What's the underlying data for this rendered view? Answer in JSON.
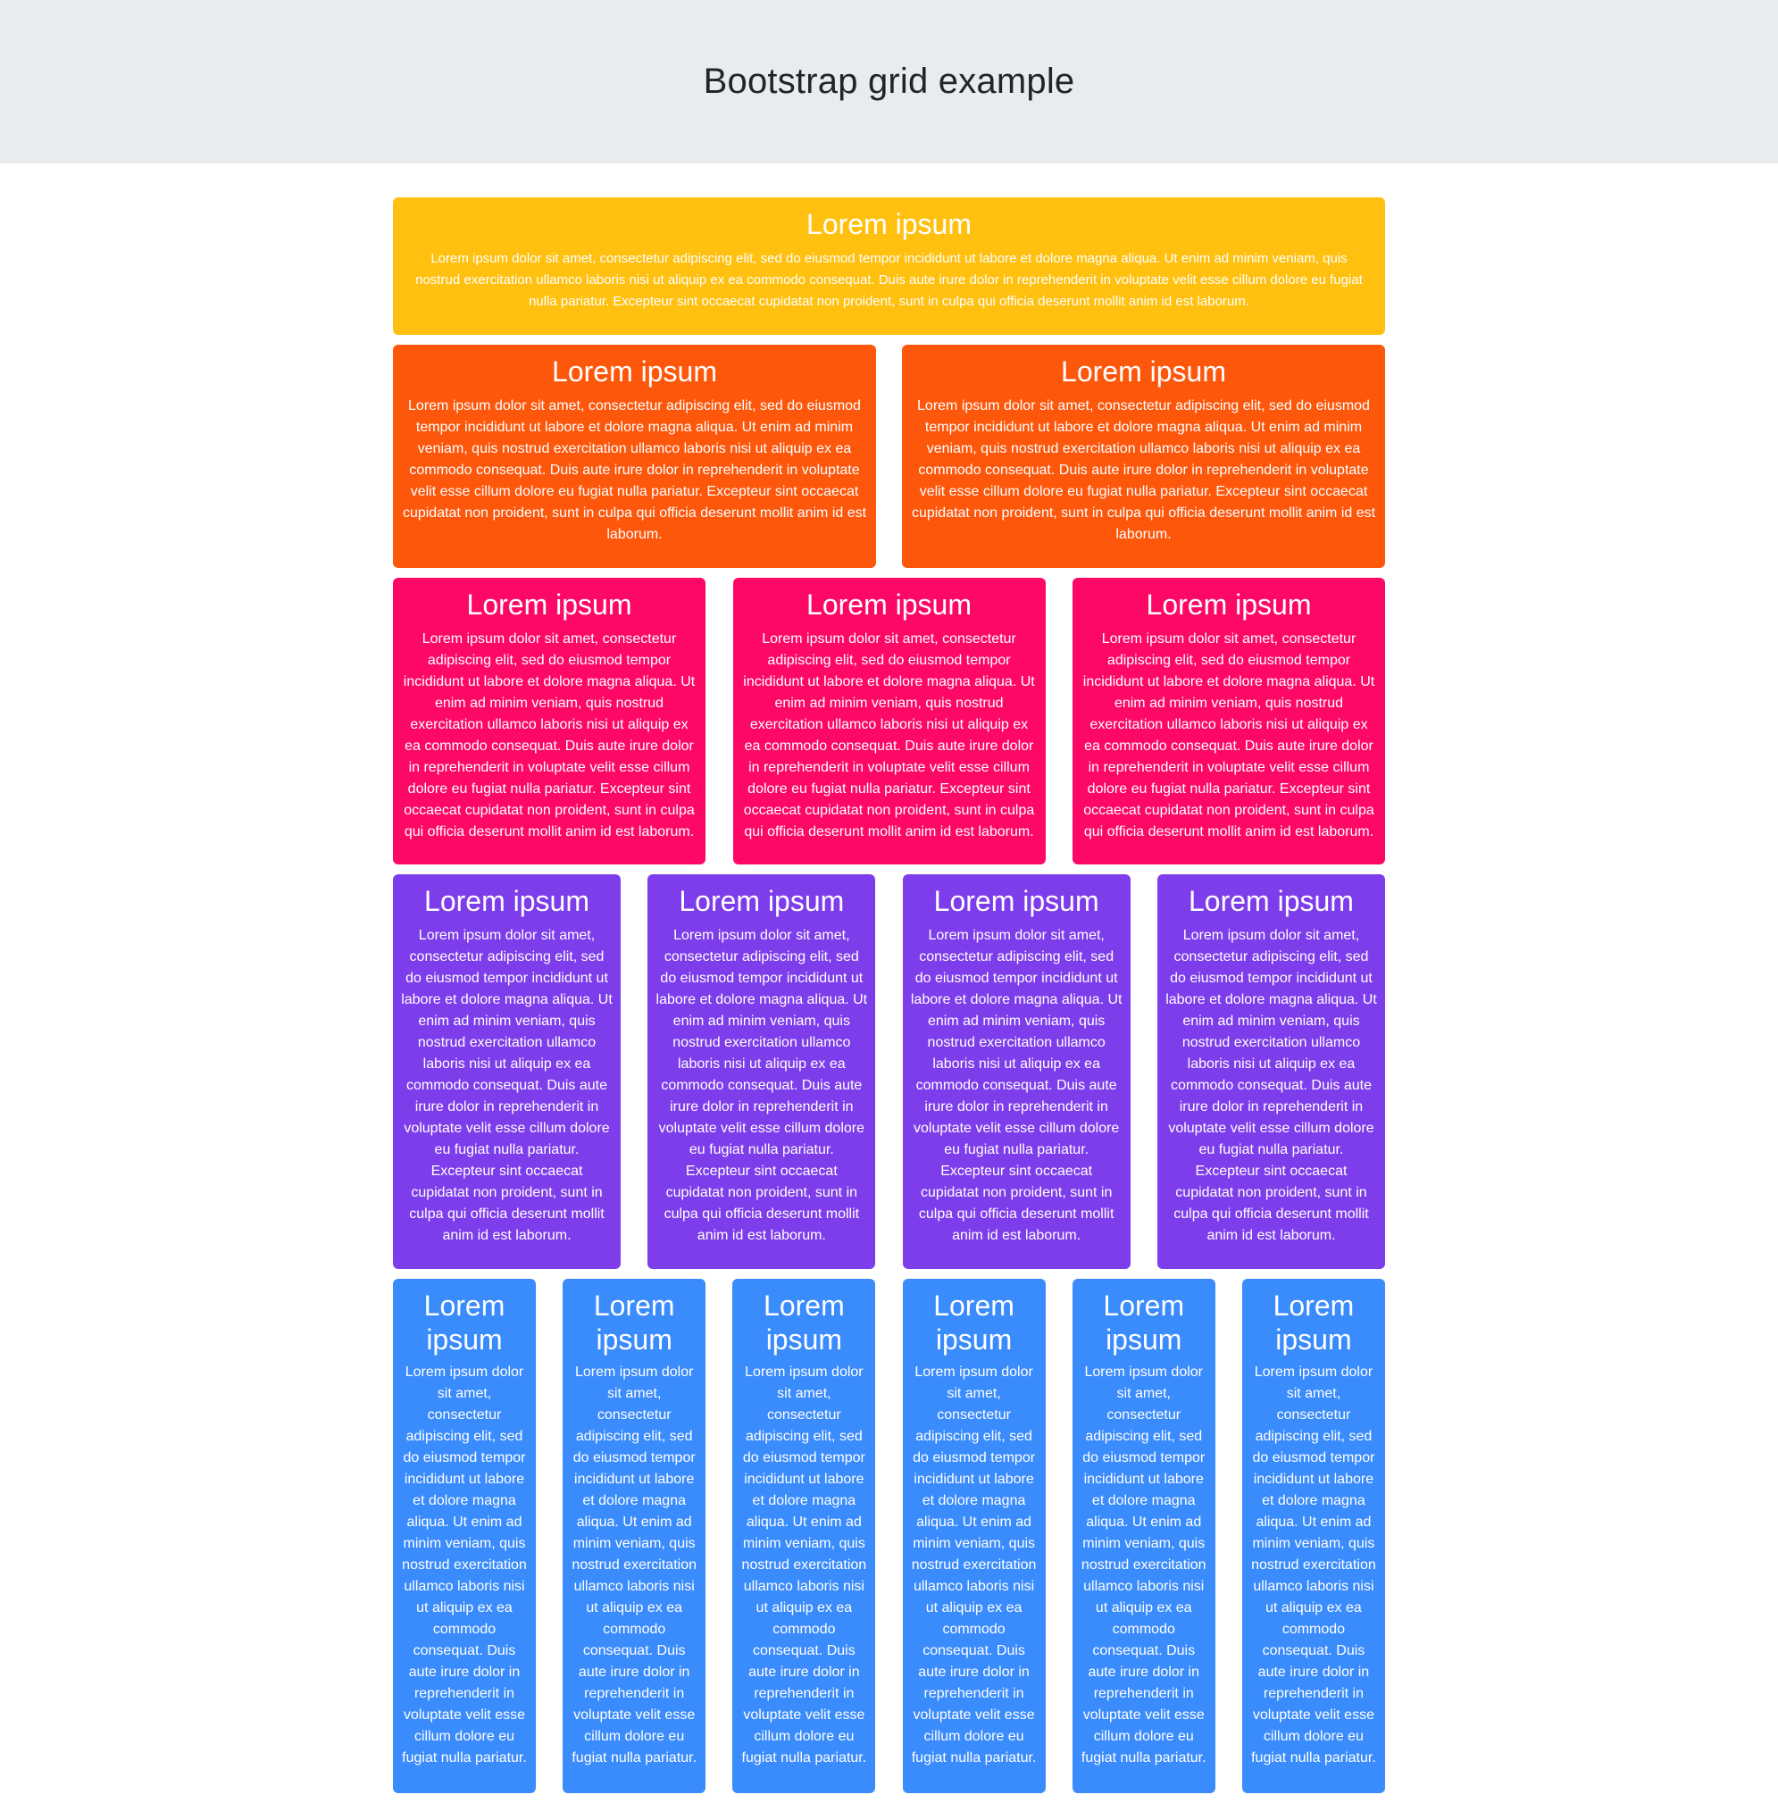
{
  "header": {
    "title": "Bootstrap grid example"
  },
  "colors": {
    "header_bg": "#e9ecef",
    "row1": "#ffc010",
    "row2": "#fd570c",
    "row3": "#fd0867",
    "row4": "#7e3deb",
    "row5": "#3a8bfc",
    "text": "#ffffff"
  },
  "card": {
    "heading": "Lorem ipsum",
    "body": "Lorem ipsum dolor sit amet, consectetur adipiscing elit, sed do eiusmod tempor incididunt ut labore et dolore magna aliqua. Ut enim ad minim veniam, quis nostrud exercitation ullamco laboris nisi ut aliquip ex ea commodo consequat. Duis aute irure dolor in reprehenderit in voluptate velit esse cillum dolore eu fugiat nulla pariatur. Excepteur sint occaecat cupidatat non proident, sunt in culpa qui officia deserunt mollit anim id est laborum.",
    "body_truncated": "Lorem ipsum dolor sit amet, consectetur adipiscing elit, sed do eiusmod tempor incididunt ut labore et dolore magna aliqua. Ut enim ad minim veniam, quis nostrud exercitation ullamco laboris nisi ut aliquip ex ea commodo consequat. Duis aute irure dolor in reprehenderit in voluptate velit esse cillum dolore eu fugiat nulla pariatur."
  },
  "rows": [
    {
      "columns": 1
    },
    {
      "columns": 2
    },
    {
      "columns": 3
    },
    {
      "columns": 4
    },
    {
      "columns": 6
    }
  ]
}
